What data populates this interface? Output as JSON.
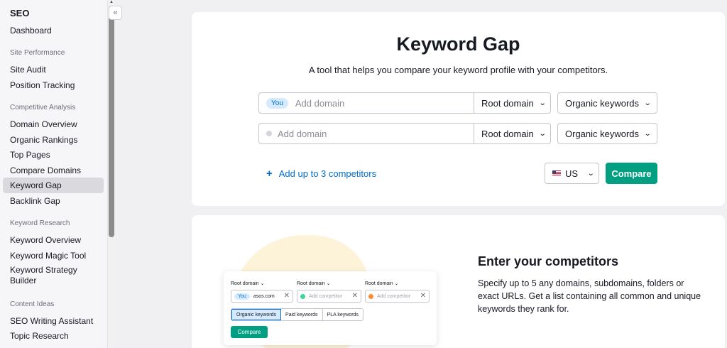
{
  "sidebar": {
    "title": "SEO",
    "dashboard": "Dashboard",
    "sections": {
      "site_performance": "Site Performance",
      "competitive_analysis": "Competitive Analysis",
      "keyword_research": "Keyword Research",
      "content_ideas": "Content Ideas"
    },
    "items": {
      "site_audit": "Site Audit",
      "position_tracking": "Position Tracking",
      "domain_overview": "Domain Overview",
      "organic_rankings": "Organic Rankings",
      "top_pages": "Top Pages",
      "compare_domains": "Compare Domains",
      "keyword_gap": "Keyword Gap",
      "backlink_gap": "Backlink Gap",
      "keyword_overview": "Keyword Overview",
      "keyword_magic_tool": "Keyword Magic Tool",
      "keyword_strategy_builder": "Keyword Strategy Builder",
      "seo_writing_assistant": "SEO Writing Assistant",
      "topic_research": "Topic Research"
    },
    "collapse_icon": "«"
  },
  "main": {
    "title": "Keyword Gap",
    "subtitle": "A tool that helps you compare your keyword profile with your competitors.",
    "you_label": "You",
    "domain_placeholder": "Add domain",
    "root_domain": "Root domain",
    "organic_keywords": "Organic keywords",
    "add_competitors": "Add up to 3 competitors",
    "country": "US",
    "compare": "Compare",
    "accent_color": "#009f81",
    "link_color": "#006dca"
  },
  "illustration": {
    "root_domain": "Root domain",
    "you": "You",
    "domain": "asos.com",
    "add_competitor": "Add competitor",
    "tab_organic": "Organic keywords",
    "tab_paid": "Paid keywords",
    "tab_pla": "PLA keywords",
    "compare": "Compare"
  },
  "info": {
    "title": "Enter your competitors",
    "text": "Specify up to 5 any domains, subdomains, folders or exact URLs. Get a list containing all common and unique keywords they rank for."
  }
}
